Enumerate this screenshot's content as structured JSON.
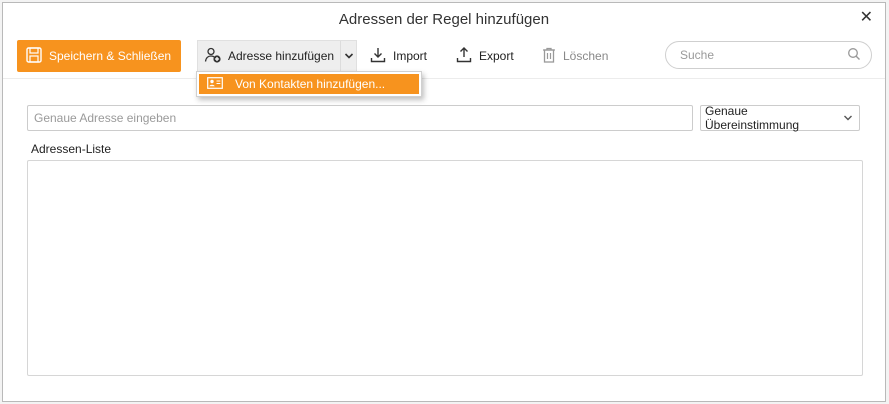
{
  "window": {
    "title": "Adressen der Regel hinzufügen"
  },
  "toolbar": {
    "save_close_label": "Speichern & Schließen",
    "add_address_label": "Adresse hinzufügen",
    "import_label": "Import",
    "export_label": "Export",
    "delete_label": "Löschen"
  },
  "search": {
    "placeholder": "Suche"
  },
  "dropdown": {
    "item_label": "Von Kontakten hinzufügen..."
  },
  "form": {
    "address_placeholder": "Genaue Adresse eingeben",
    "match_value": "Genaue Übereinstimmung",
    "list_label": "Adressen-Liste"
  },
  "list": {
    "items": []
  },
  "colors": {
    "accent": "#f7931e"
  },
  "icons": {
    "close": "close-icon",
    "save": "save-icon",
    "add_contact": "add-contact-icon",
    "import": "download-icon",
    "export": "upload-icon",
    "delete": "trash-icon",
    "search": "search-icon",
    "contact_card": "contact-card-icon"
  }
}
